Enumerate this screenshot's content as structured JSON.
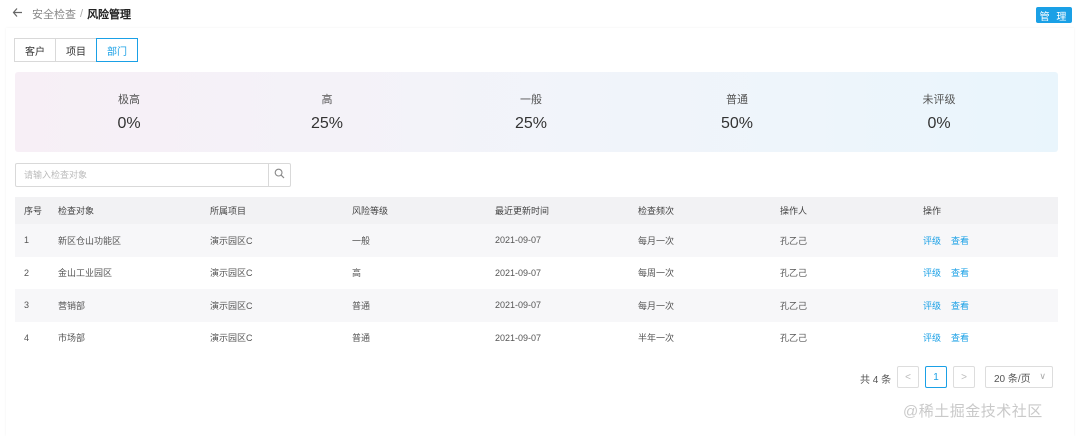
{
  "breadcrumb": {
    "parent": "安全检查",
    "separator": "/",
    "current": "风险管理"
  },
  "header": {
    "manage_label": "管 理"
  },
  "tabs": [
    {
      "label": "客户",
      "active": false
    },
    {
      "label": "项目",
      "active": false
    },
    {
      "label": "部门",
      "active": true
    }
  ],
  "stats": [
    {
      "label": "极高",
      "value": "0%"
    },
    {
      "label": "高",
      "value": "25%"
    },
    {
      "label": "一般",
      "value": "25%"
    },
    {
      "label": "普通",
      "value": "50%"
    },
    {
      "label": "未评级",
      "value": "0%"
    }
  ],
  "search": {
    "placeholder": "请输入检查对象",
    "icon": "search-icon"
  },
  "table": {
    "columns": [
      "序号",
      "检查对象",
      "所属项目",
      "风险等级",
      "最近更新时间",
      "检查频次",
      "操作人",
      "操作"
    ],
    "rows": [
      {
        "no": "1",
        "target": "新区仓山功能区",
        "project": "演示园区C",
        "level": "一般",
        "updated": "2021-09-07",
        "freq": "每月一次",
        "operator": "孔乙己",
        "actions": [
          "评级",
          "查看"
        ]
      },
      {
        "no": "2",
        "target": "金山工业园区",
        "project": "演示园区C",
        "level": "高",
        "updated": "2021-09-07",
        "freq": "每周一次",
        "operator": "孔乙己",
        "actions": [
          "评级",
          "查看"
        ]
      },
      {
        "no": "3",
        "target": "营销部",
        "project": "演示园区C",
        "level": "普通",
        "updated": "2021-09-07",
        "freq": "每月一次",
        "operator": "孔乙己",
        "actions": [
          "评级",
          "查看"
        ]
      },
      {
        "no": "4",
        "target": "市场部",
        "project": "演示园区C",
        "level": "普通",
        "updated": "2021-09-07",
        "freq": "半年一次",
        "operator": "孔乙己",
        "actions": [
          "评级",
          "查看"
        ]
      }
    ]
  },
  "pagination": {
    "total_text": "共 4 条",
    "prev": "<",
    "current_page": "1",
    "next": ">",
    "page_size": "20 条/页",
    "chevron": "∨"
  },
  "watermark": "@稀土掘金技术社区",
  "colors": {
    "accent": "#1aa0e6"
  }
}
